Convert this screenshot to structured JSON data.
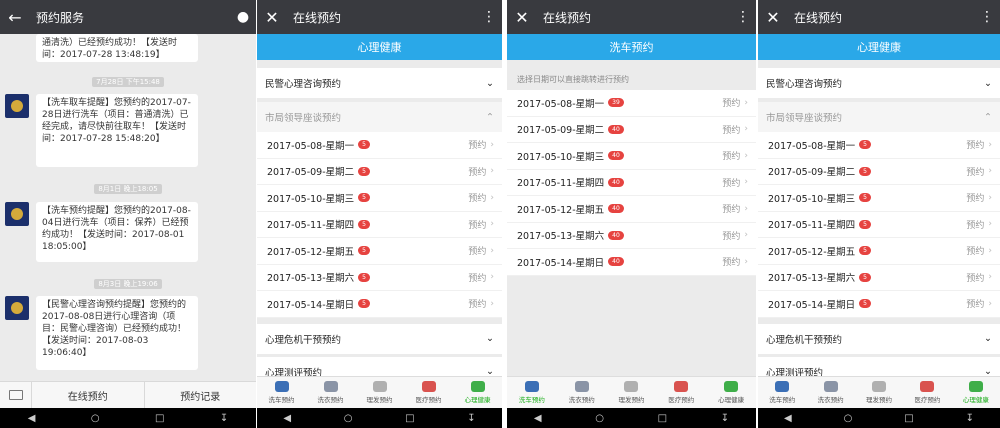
{
  "chat": {
    "title": "预约服务",
    "messages": [
      {
        "text": "通清洗）已经预约成功！【发送时间：2017-07-28 13:48:19】"
      },
      {
        "time": "7月28日 下午15:48",
        "text": "【洗车取车提醒】您预约的2017-07-28日进行洗车（项目：普通清洗）已经完成，请尽快前往取车！【发送时间：2017-07-28 15:48:20】"
      },
      {
        "time": "8月1日 晚上18:05",
        "text": "【洗车预约提醒】您预约的2017-08-04日进行洗车（项目：保养）已经预约成功！【发送时间：2017-08-01 18:05:00】"
      },
      {
        "time": "8月3日 晚上19:06",
        "text": "【民警心理咨询预约提醒】您预约的2017-08-08日进行心理咨询（项目：民警心理咨询）已经预约成功！【发送时间：2017-08-03 19:06:40】"
      }
    ],
    "bottom": {
      "book": "在线预约",
      "records": "预约记录"
    }
  },
  "screens": [
    {
      "title": "在线预约",
      "banner": "心理健康",
      "top_section": "民警心理咨询预约",
      "open_section": "市局领导座谈预约",
      "rows": [
        {
          "date": "2017-05-08-星期一",
          "count": "5"
        },
        {
          "date": "2017-05-09-星期二",
          "count": "5"
        },
        {
          "date": "2017-05-10-星期三",
          "count": "5"
        },
        {
          "date": "2017-05-11-星期四",
          "count": "5"
        },
        {
          "date": "2017-05-12-星期五",
          "count": "5"
        },
        {
          "date": "2017-05-13-星期六",
          "count": "5"
        },
        {
          "date": "2017-05-14-星期日",
          "count": "5"
        }
      ],
      "bottom_sections": [
        "心理危机干预预约",
        "心理测评预约"
      ],
      "active_tab": 4
    },
    {
      "title": "在线预约",
      "banner": "洗车预约",
      "hint": "选择日期可以直接跳转进行预约",
      "rows": [
        {
          "date": "2017-05-08-星期一",
          "count": "39"
        },
        {
          "date": "2017-05-09-星期二",
          "count": "40"
        },
        {
          "date": "2017-05-10-星期三",
          "count": "40"
        },
        {
          "date": "2017-05-11-星期四",
          "count": "40"
        },
        {
          "date": "2017-05-12-星期五",
          "count": "40"
        },
        {
          "date": "2017-05-13-星期六",
          "count": "40"
        },
        {
          "date": "2017-05-14-星期日",
          "count": "40"
        }
      ],
      "active_tab": 0
    },
    {
      "title": "在线预约",
      "banner": "心理健康",
      "top_section": "民警心理咨询预约",
      "open_section": "市局领导座谈预约",
      "rows": [
        {
          "date": "2017-05-08-星期一",
          "count": "5"
        },
        {
          "date": "2017-05-09-星期二",
          "count": "5"
        },
        {
          "date": "2017-05-10-星期三",
          "count": "5"
        },
        {
          "date": "2017-05-11-星期四",
          "count": "5"
        },
        {
          "date": "2017-05-12-星期五",
          "count": "5"
        },
        {
          "date": "2017-05-13-星期六",
          "count": "5"
        },
        {
          "date": "2017-05-14-星期日",
          "count": "5"
        }
      ],
      "bottom_sections": [
        "心理危机干预预约",
        "心理测评预约"
      ],
      "active_tab": 4
    }
  ],
  "row_action": "预约",
  "tabs": [
    {
      "label": "洗车预约",
      "color": "#3b6fb6"
    },
    {
      "label": "洗衣预约",
      "color": "#8a94a6"
    },
    {
      "label": "理发预约",
      "color": "#b0b0b0"
    },
    {
      "label": "医疗预约",
      "color": "#d9534f"
    },
    {
      "label": "心理健康",
      "color": "#3fae49"
    }
  ],
  "colors": {
    "accent": "#2aa8e8",
    "active_tab": "#1aad19",
    "badge": "#e64340",
    "topbar": "#393a3f"
  }
}
